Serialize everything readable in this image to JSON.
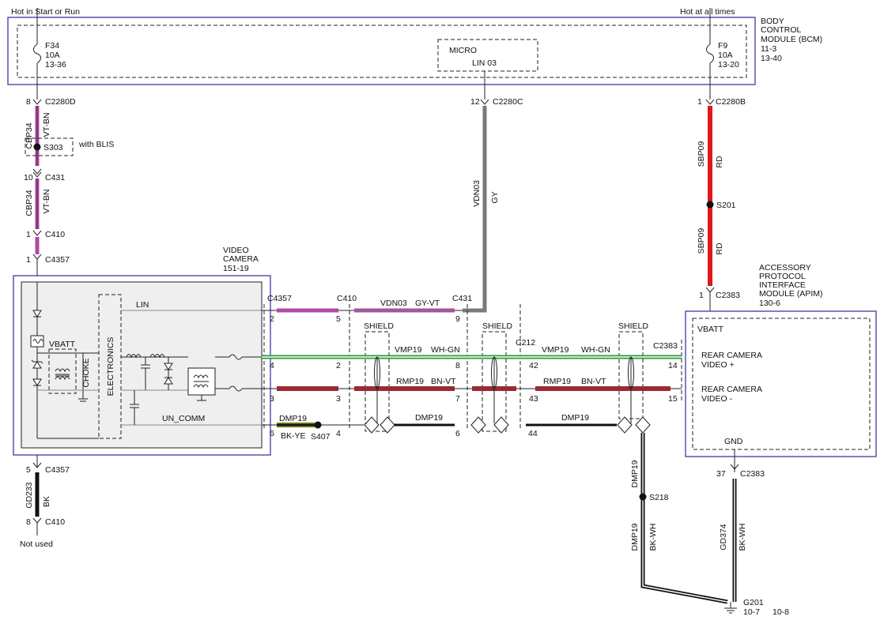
{
  "top": {
    "left_power": "Hot in Start or Run",
    "right_power": "Hot at all times"
  },
  "bcm": {
    "title": [
      "BODY",
      "CONTROL",
      "MODULE (BCM)"
    ],
    "refs": [
      "11-3",
      "13-40"
    ],
    "fuse_left": {
      "name": "F34",
      "rating": "10A",
      "ref": "13-36"
    },
    "fuse_right": {
      "name": "F9",
      "rating": "10A",
      "ref": "13-20"
    },
    "micro_label": "MICRO",
    "lin_label": "LIN 03"
  },
  "left_branch": {
    "c1": {
      "pin": "8",
      "name": "C2280D"
    },
    "wire1": {
      "circuit": "CBP34",
      "color": "VT-BN"
    },
    "splice": {
      "name": "S303",
      "note": "with BLIS"
    },
    "c2": {
      "pin": "10",
      "name": "C431"
    },
    "wire2": {
      "circuit": "CBP34",
      "color": "VT-BN"
    },
    "c3": {
      "pin": "1",
      "name": "C410"
    },
    "c4": {
      "pin": "1",
      "name": "C4357"
    },
    "c5": {
      "pin": "5",
      "name": "C4357"
    },
    "ground_wire": {
      "circuit": "GD233",
      "color": "BK"
    },
    "c6": {
      "pin": "8",
      "name": "C410"
    },
    "not_used": "Not used"
  },
  "camera": {
    "title": [
      "VIDEO",
      "CAMERA"
    ],
    "ref": "151-19",
    "lin": "LIN",
    "vbatt": "VBATT",
    "choke": "CHOKE",
    "electronics": "ELECTRONICS",
    "un_comm": "UN_COMM"
  },
  "center_wire": {
    "pin": "12",
    "connector": "C2280C",
    "circuit": "VDN03",
    "color": "GY"
  },
  "right_branch": {
    "c1": {
      "pin": "1",
      "name": "C2280B"
    },
    "wire1": {
      "circuit": "SBP09",
      "color": "RD"
    },
    "splice": "S201",
    "wire2": {
      "circuit": "SBP09",
      "color": "RD"
    },
    "c2": {
      "pin": "1",
      "name": "C2383"
    }
  },
  "apim": {
    "title": [
      "ACCESSORY",
      "PROTOCOL",
      "INTERFACE",
      "MODULE (APIM)"
    ],
    "ref": "130-6",
    "vbatt": "VBATT",
    "video_plus": [
      "REAR CAMERA",
      "VIDEO +"
    ],
    "video_minus": [
      "REAR CAMERA",
      "VIDEO -"
    ],
    "gnd": "GND",
    "gnd_pin": "37",
    "gnd_connector": "C2383"
  },
  "harness": {
    "connectors": [
      "C4357",
      "C410",
      "C431",
      "C212",
      "C2383"
    ],
    "shield": "SHIELD",
    "lin_row": {
      "pins": [
        "2",
        "5",
        "9"
      ],
      "circuit": "VDN03",
      "color": "GY-VT"
    },
    "vp_row": {
      "pins": [
        "4",
        "2",
        "8",
        "42",
        "14"
      ],
      "circuit": "VMP19",
      "color": "WH-GN"
    },
    "rm_row": {
      "pins": [
        "3",
        "3",
        "7",
        "43",
        "15"
      ],
      "circuit": "RMP19",
      "color": "BN-VT"
    },
    "drain_row": {
      "pins": [
        "6",
        "4",
        "6",
        "44"
      ],
      "circuit": "DMP19",
      "color": "BK-YE",
      "splice": "S407"
    }
  },
  "drain_vertical": {
    "circuit_a": "DMP19",
    "splice": "S218",
    "circuit_b": "DMP19",
    "color_b": "BK-WH"
  },
  "ground_wire": {
    "circuit": "GD374",
    "color": "BK-WH"
  },
  "ground_point": {
    "name": "G201",
    "ref1": "10-7",
    "ref2": "10-8"
  },
  "wire_colors": {
    "violet_brown": "#b04aa6",
    "red": "#e0171b",
    "gray": "#7a7a7a",
    "green": "#2f9a3a",
    "brown_violet": "#9a2a34",
    "black": "#111111",
    "box_blue": "#3a3aa8"
  }
}
